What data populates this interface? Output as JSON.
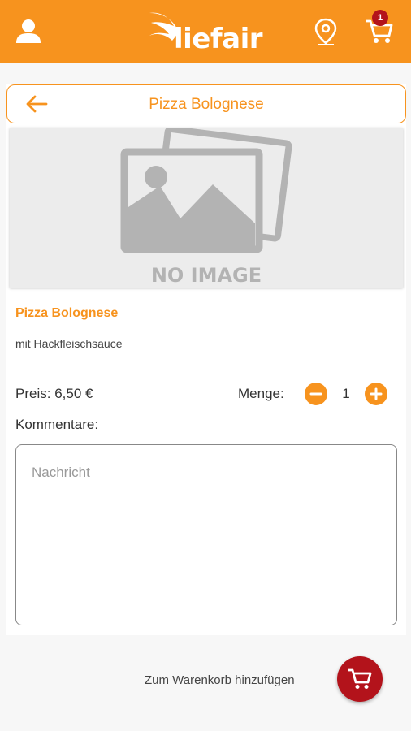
{
  "header": {
    "brand": "liefair",
    "cart_count": "1",
    "icons": [
      "user-icon",
      "location-pin-icon",
      "cart-icon"
    ],
    "accent_color": "#f7931e",
    "badge_color": "#b3131b"
  },
  "title_bar": {
    "title": "Pizza Bolognese",
    "back_icon": "arrow-left-icon"
  },
  "image": {
    "placeholder_text": "NO IMAGE"
  },
  "product": {
    "name": "Pizza Bolognese",
    "description": "mit Hackfleischsauce",
    "price_label": "Preis:",
    "price": "6,50 €",
    "quantity_label": "Menge:",
    "quantity": "1"
  },
  "comments": {
    "label": "Kommentare:",
    "placeholder": "Nachricht"
  },
  "footer": {
    "add_to_cart_label": "Zum Warenkorb hinzufügen",
    "add_to_cart_color": "#b3131b"
  }
}
